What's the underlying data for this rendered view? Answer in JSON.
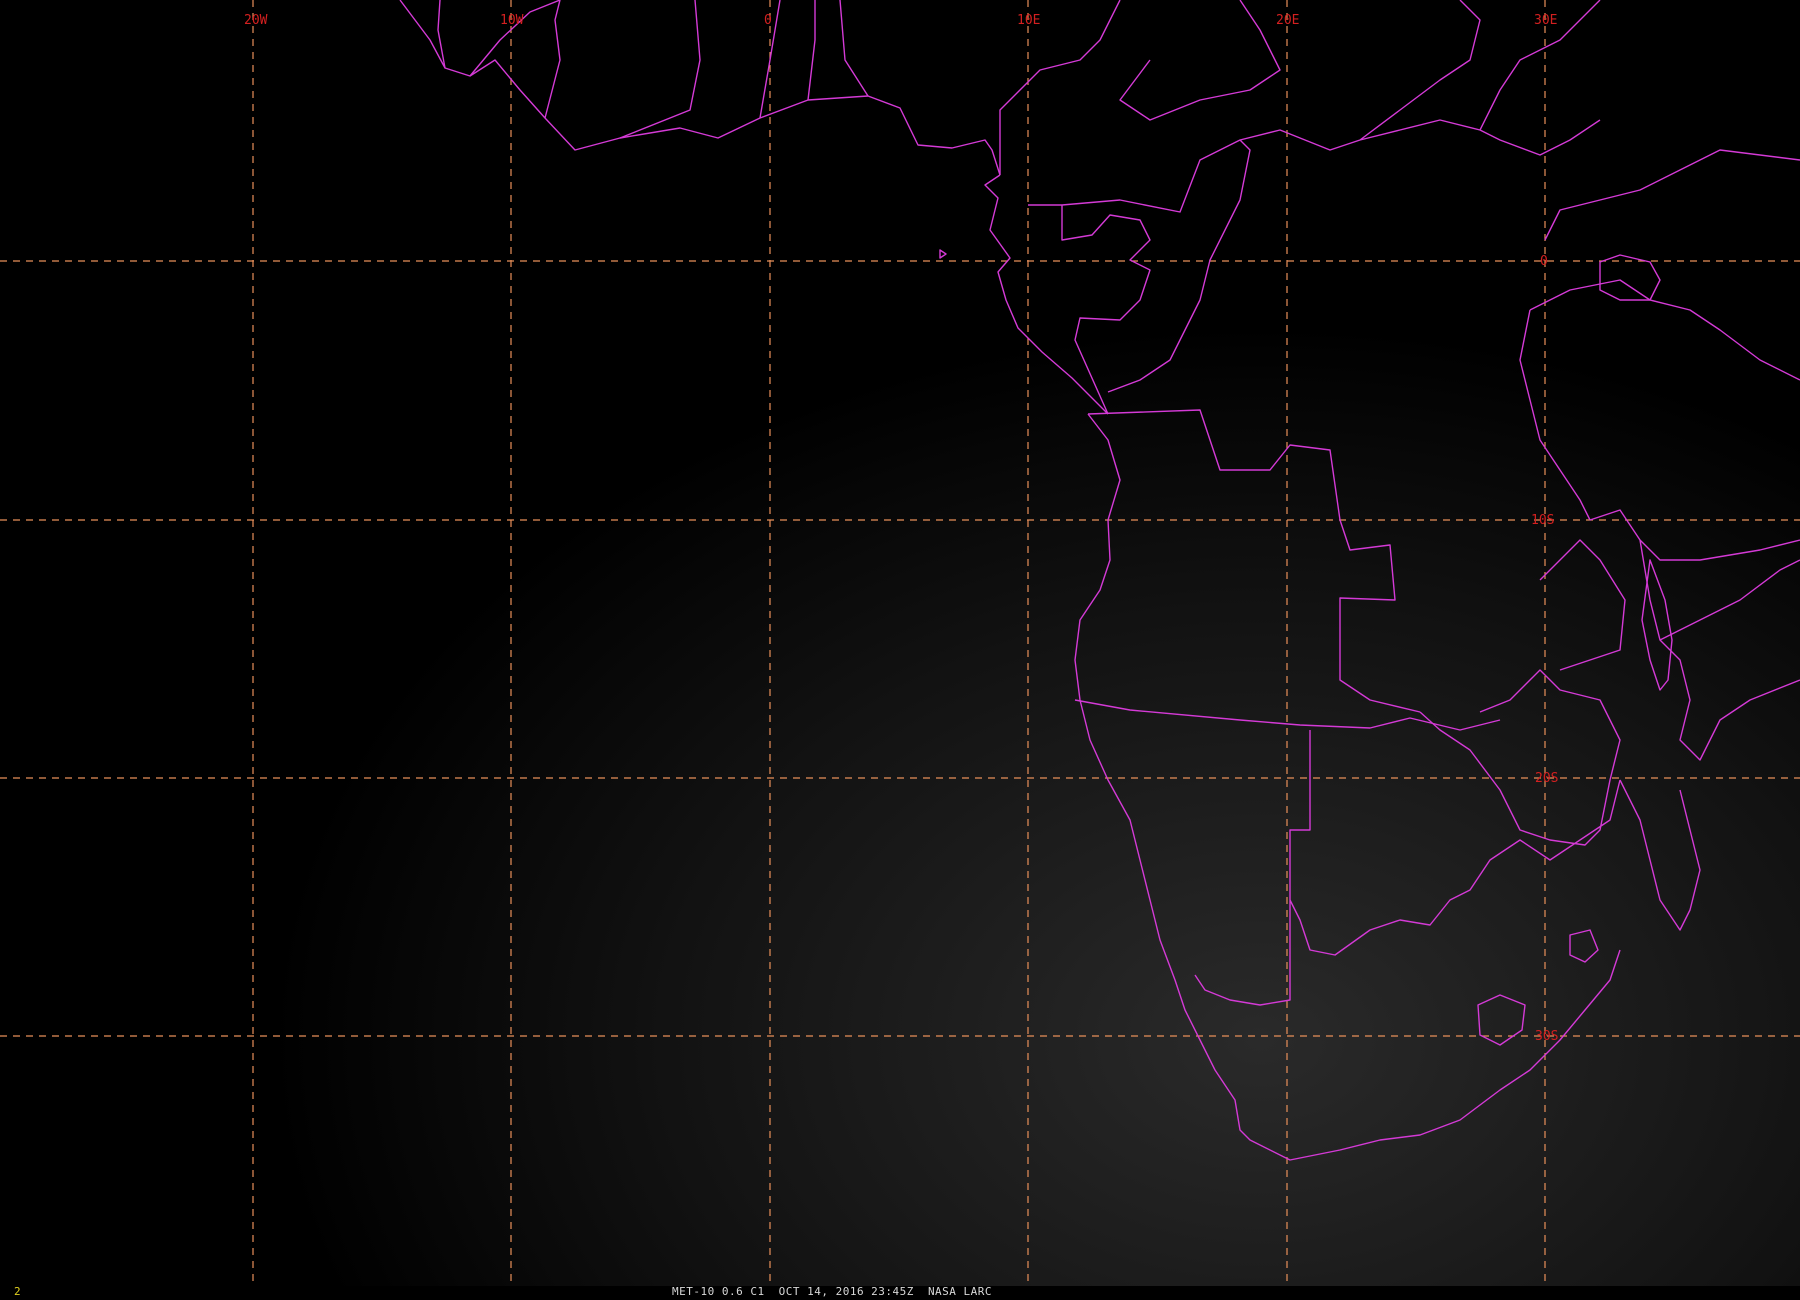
{
  "map": {
    "colors": {
      "background": "#000000",
      "boundaries": "#d43ad6",
      "gridlines": "#e8905a",
      "grid_labels": "#d42020",
      "caption": "#d8d8d8",
      "frame_number": "#e0d020"
    },
    "longitude_labels": [
      "20W",
      "10W",
      "0",
      "10E",
      "20E",
      "30E"
    ],
    "latitude_labels": [
      "0",
      "10S",
      "20S",
      "30S"
    ]
  },
  "caption": {
    "frame_number": "2",
    "satellite": "MET-10 0.6 C1",
    "datetime": "OCT 14, 2016 23:45Z",
    "source": "NASA LARC"
  }
}
